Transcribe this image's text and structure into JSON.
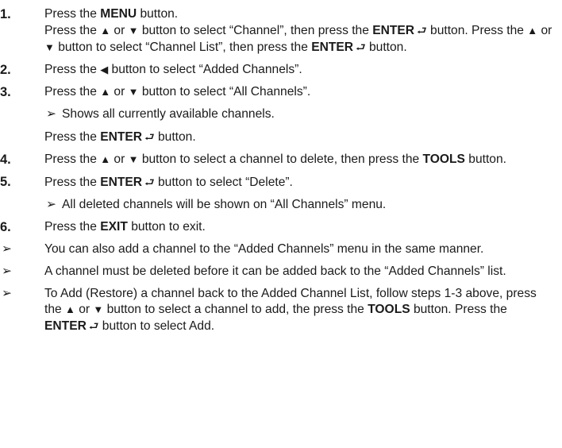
{
  "glyphs": {
    "up": "▲",
    "down": "▼",
    "left": "◀",
    "enter": "⮐",
    "bullet": "➢"
  },
  "steps": [
    {
      "num": "1.",
      "l1_a": "Press the ",
      "l1_b": "MENU",
      "l1_c": " button.",
      "l2_a": "Press the ",
      "l2_b": " or ",
      "l2_c": " button to select “Channel”, then press the ",
      "l2_d": "ENTER",
      "l2_e": " button. Press the ",
      "l2_f": " or ",
      "l2_g": " button to select “Channel List”, then press the ",
      "l2_h": "ENTER",
      "l2_i": " button."
    },
    {
      "num": "2.",
      "a": "Press the ",
      "b": " button to select “Added Channels”."
    },
    {
      "num": "3.",
      "a": "Press the ",
      "b": " or ",
      "c": " button to select “All Channels”.",
      "sub": "Shows all currently available channels.",
      "after_a": "Press the ",
      "after_b": "ENTER",
      "after_c": " button."
    },
    {
      "num": "4.",
      "a": "Press the ",
      "b": " or ",
      "c": " button to select a channel to delete, then press the ",
      "d": "TOOLS",
      "e": " button."
    },
    {
      "num": "5.",
      "a": "Press the ",
      "b": "ENTER",
      "c": " button to select “Delete”.",
      "sub": "All deleted channels will be shown on “All Channels” menu."
    },
    {
      "num": "6.",
      "a": "Press the ",
      "b": "EXIT",
      "c": " button to exit."
    }
  ],
  "notes": [
    {
      "text": "You can also add a channel to the “Added Channels” menu in the same manner."
    },
    {
      "text": "A channel must be deleted before it can be added back to the “Added Channels” list."
    },
    {
      "a": "To Add (Restore) a channel back to the Added Channel List, follow steps 1-3 above, press the ",
      "b": " or ",
      "c": " button to select a channel to add, the press the ",
      "d": "TOOLS",
      "e": " button. Press the ",
      "f": "ENTER",
      "g": " button to select Add."
    }
  ]
}
